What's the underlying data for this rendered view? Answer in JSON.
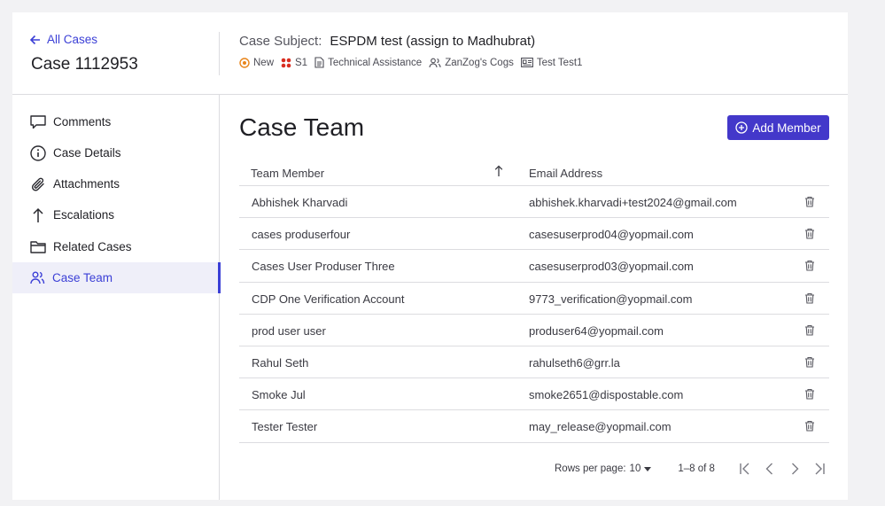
{
  "header": {
    "back_label": "All Cases",
    "case_number": "Case 1112953",
    "subject_label": "Case Subject:",
    "subject_value": "ESPDM test (assign to Madhubrat)",
    "meta": {
      "status": "New",
      "severity": "S1",
      "type": "Technical Assistance",
      "account": "ZanZog's Cogs",
      "contact": "Test Test1"
    }
  },
  "sidebar": {
    "items": [
      {
        "label": "Comments",
        "icon": "comment-icon"
      },
      {
        "label": "Case Details",
        "icon": "info-icon"
      },
      {
        "label": "Attachments",
        "icon": "paperclip-icon"
      },
      {
        "label": "Escalations",
        "icon": "arrow-up-icon"
      },
      {
        "label": "Related Cases",
        "icon": "folder-icon"
      },
      {
        "label": "Case Team",
        "icon": "users-icon",
        "active": true
      }
    ]
  },
  "main": {
    "title": "Case Team",
    "add_button": "Add Member",
    "columns": {
      "member": "Team Member",
      "email": "Email Address"
    },
    "rows": [
      {
        "name": "Abhishek Kharvadi",
        "email": "abhishek.kharvadi+test2024@gmail.com"
      },
      {
        "name": "cases produserfour",
        "email": "casesuserprod04@yopmail.com"
      },
      {
        "name": "Cases User Produser Three",
        "email": "casesuserprod03@yopmail.com"
      },
      {
        "name": "CDP One Verification Account",
        "email": "9773_verification@yopmail.com"
      },
      {
        "name": "prod user user",
        "email": "produser64@yopmail.com"
      },
      {
        "name": "Rahul Seth",
        "email": "rahulseth6@grr.la"
      },
      {
        "name": "Smoke Jul",
        "email": "smoke2651@dispostable.com"
      },
      {
        "name": "Tester Tester",
        "email": "may_release@yopmail.com"
      }
    ],
    "pagination": {
      "rows_per_page_label": "Rows per page:",
      "rows_per_page_value": "10",
      "range": "1–8 of 8"
    }
  },
  "colors": {
    "accent": "#3b3fd6",
    "button": "#4338ca",
    "status": "#e8851c",
    "severity": "#d92d20"
  }
}
